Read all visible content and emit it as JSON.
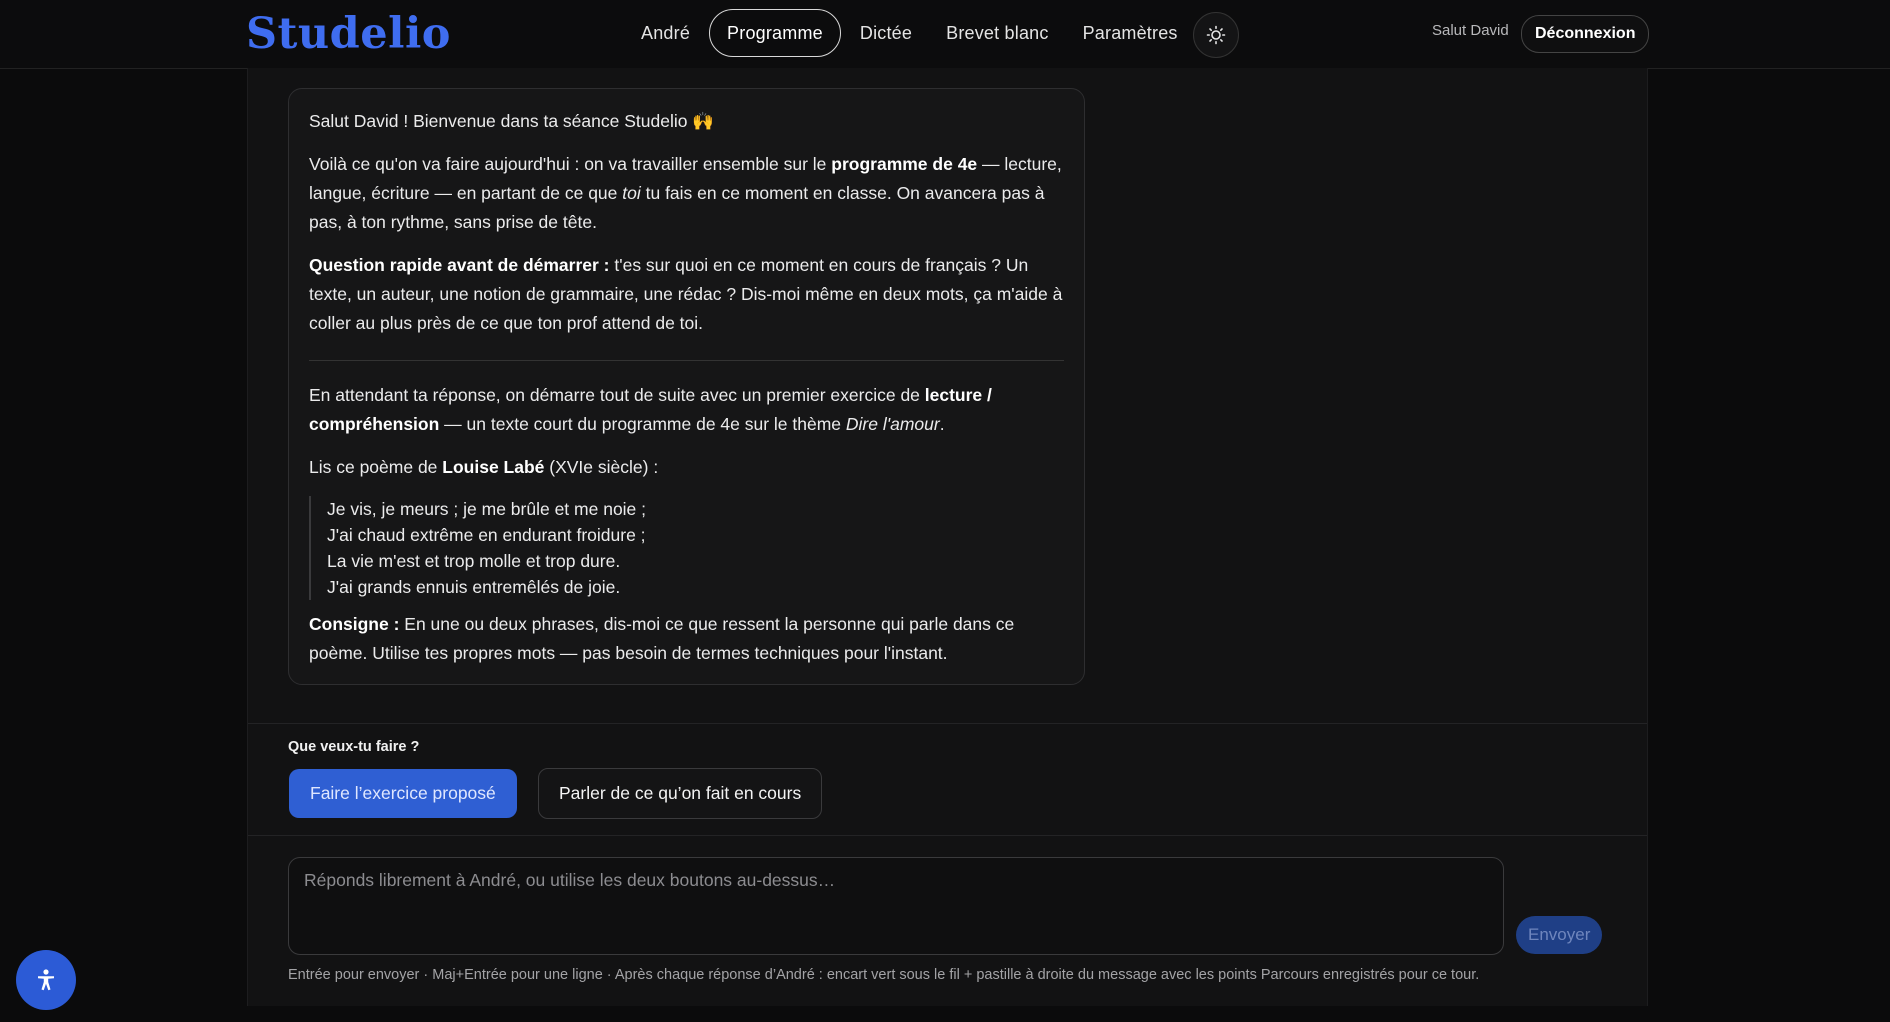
{
  "header": {
    "logo": "Studelio",
    "nav": [
      {
        "label": "André"
      },
      {
        "label": "Programme",
        "active": true
      },
      {
        "label": "Dictée"
      },
      {
        "label": "Brevet blanc"
      },
      {
        "label": "Paramètres"
      }
    ],
    "theme_icon": "sun-icon",
    "greeting": "Salut David",
    "logout_label": "Déconnexion"
  },
  "message": {
    "greeting": "Salut David ! Bienvenue dans ta séance Studelio 🙌",
    "intro_a": "Voilà ce qu'on va faire aujourd'hui : on va travailler ensemble sur le ",
    "intro_b": "programme de 4e",
    "intro_c": " — lecture, langue, écriture — en partant de ce que ",
    "intro_d": "toi",
    "intro_e": " tu fais en ce moment en classe. On avancera pas à pas, à ton rythme, sans prise de tête.",
    "question_label": "Question rapide avant de démarrer :",
    "question_text": " t'es sur quoi en ce moment en cours de français ? Un texte, un auteur, une notion de grammaire, une rédac ? Dis-moi même en deux mots, ça m'aide à coller au plus près de ce que ton prof attend de toi.",
    "exercise_a": "En attendant ta réponse, on démarre tout de suite avec un premier exercice de ",
    "exercise_b": "lecture / compréhension",
    "exercise_c": " — un texte court du programme de 4e sur le thème ",
    "exercise_d": "Dire l'amour",
    "exercise_e": ".",
    "poem_intro_a": "Lis ce poème de ",
    "poem_intro_b": "Louise Labé",
    "poem_intro_c": " (XVIe siècle) :",
    "poem": [
      "Je vis, je meurs ; je me brûle et me noie ;",
      "J'ai chaud extrême en endurant froidure ;",
      "La vie m'est et trop molle et trop dure.",
      "J'ai grands ennuis entremêlés de joie."
    ],
    "consigne_label": "Consigne :",
    "consigne_text": " En une ou deux phrases, dis-moi ce que ressent la personne qui parle dans ce poème. Utilise tes propres mots — pas besoin de termes techniques pour l'instant."
  },
  "choices": {
    "title": "Que veux-tu faire ?",
    "primary": "Faire l’exercice proposé",
    "secondary": "Parler de ce qu’on fait en cours"
  },
  "composer": {
    "placeholder": "Réponds librement à André, ou utilise les deux boutons au-dessus…",
    "send_label": "Envoyer",
    "hint": "Entrée pour envoyer · Maj+Entrée pour une ligne · Après chaque réponse d’André : encart vert sous le fil + pastille à droite du message avec les points Parcours enregistrés pour ce tour."
  },
  "accessibility_icon": "accessibility-icon",
  "colors": {
    "accent": "#2f5fd3",
    "logo": "#3f6df0",
    "logo_dot": "#e2503a",
    "background": "#0b0b0c"
  }
}
